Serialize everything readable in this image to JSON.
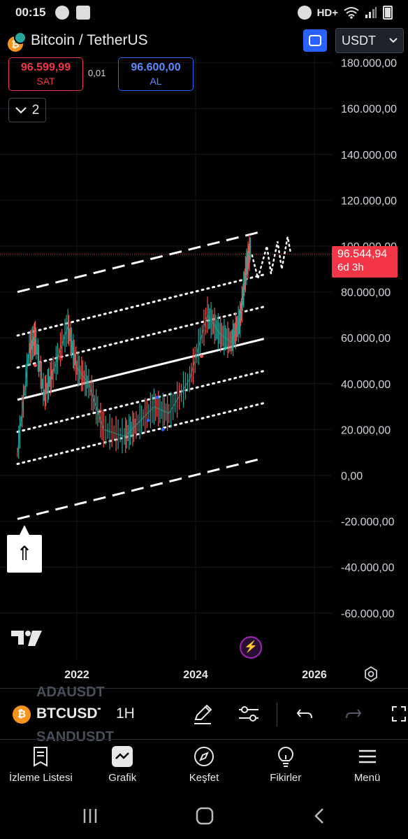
{
  "status_bar": {
    "time": "00:15",
    "network": "HD+"
  },
  "header": {
    "title": "Bitcoin / TetherUS",
    "currency": "USDT",
    "icon": "bitcoin-icon"
  },
  "trade": {
    "sell_price": "96.599,99",
    "sell_label": "SAT",
    "spread": "0,01",
    "buy_price": "96.600,00",
    "buy_label": "AL",
    "indicators_count": "2"
  },
  "price_axis": {
    "labels": [
      "180.000,00",
      "160.000,00",
      "140.000,00",
      "120.000,00",
      "100.000,00",
      "80.000,00",
      "60.000,00",
      "40.000,00",
      "20.000,00",
      "0,00",
      "-20.000,00",
      "-40.000,00",
      "-60.000,00"
    ]
  },
  "current_price": {
    "value": "96.544,94",
    "countdown": "6d 3h",
    "color": "#f23645"
  },
  "time_axis": {
    "labels": [
      "2022",
      "2024",
      "2026"
    ]
  },
  "chart_data": {
    "type": "line",
    "x": [
      2021.0,
      2021.2,
      2021.3,
      2021.45,
      2021.6,
      2021.85,
      2022.0,
      2022.2,
      2022.45,
      2022.8,
      2023.0,
      2023.3,
      2023.55,
      2023.9,
      2024.2,
      2024.4,
      2024.6,
      2024.75,
      2024.85,
      2024.93
    ],
    "series": [
      {
        "values": [
          10000,
          55000,
          60000,
          35000,
          45000,
          65000,
          47000,
          40000,
          20000,
          17000,
          22000,
          30000,
          27000,
          42000,
          70000,
          62000,
          58000,
          68000,
          90000,
          100000
        ]
      }
    ],
    "ylim": [
      -70000,
      190000
    ],
    "channel_slope_per_year": 6400,
    "channel_lines": [
      {
        "style": "dashed",
        "y_2021": -19000
      },
      {
        "style": "dotted",
        "y_2021": 5000
      },
      {
        "style": "dotted",
        "y_2021": 19000
      },
      {
        "style": "solid",
        "y_2021": 33000
      },
      {
        "style": "dotted",
        "y_2021": 47000
      },
      {
        "style": "dotted",
        "y_2021": 61000
      },
      {
        "style": "dashed",
        "y_2021": 80000
      }
    ],
    "horizontal_line": 96545
  },
  "toolbar": {
    "symbol": "BTCUSDT",
    "interval": "1H",
    "ghost_top": "ADAUSDT",
    "ghost_bottom": "SANDUSDT"
  },
  "bottom_nav": {
    "items": [
      {
        "label": "İzleme Listesi",
        "icon": "watchlist-icon"
      },
      {
        "label": "Grafik",
        "icon": "chart-icon"
      },
      {
        "label": "Keşfet",
        "icon": "compass-icon"
      },
      {
        "label": "Fikirler",
        "icon": "lightbulb-icon"
      },
      {
        "label": "Menü",
        "icon": "menu-icon"
      }
    ]
  }
}
